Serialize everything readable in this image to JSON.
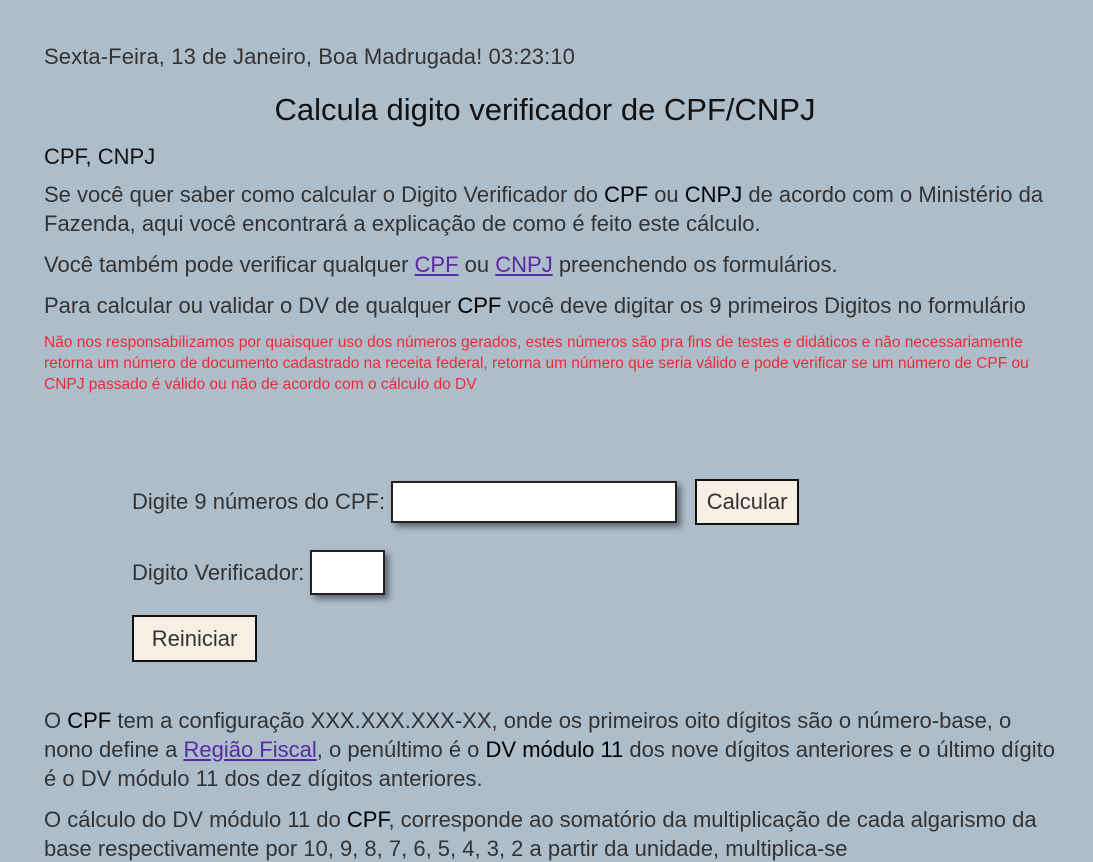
{
  "header": {
    "datetime": "Sexta-Feira, 13 de Janeiro, Boa Madrugada! 03:23:10",
    "title": "Calcula digito verificador de CPF/CNPJ",
    "subtitle": "CPF, CNPJ"
  },
  "intro": {
    "p1_part1": "Se você quer saber como calcular o Digito Verificador do ",
    "p1_cpf": "CPF",
    "p1_part2": " ou ",
    "p1_cnpj": "CNPJ",
    "p1_part3": " de acordo com o Ministério da Fazenda, aqui você encontrará a explicação de como é feito este cálculo.",
    "p2_part1": "Você também pode verificar qualquer ",
    "p2_link_cpf": "CPF",
    "p2_part2": " ou ",
    "p2_link_cnpj": "CNPJ",
    "p2_part3": " preenchendo os formulários.",
    "p3_part1": "Para calcular ou validar o DV de qualquer ",
    "p3_cpf": "CPF",
    "p3_part2": " você deve digitar os 9 primeiros Digitos no formulário",
    "disclaimer": "Não nos responsabilizamos por quaisquer uso dos números gerados, estes números são pra fins de testes e didáticos e não necessariamente retorna um número de documento cadastrado na receita federal, retorna um número que seria válido e pode verificar se um número de CPF ou CNPJ passado é válido ou não de acordo com o cálculo do DV"
  },
  "form": {
    "cpf_label": "Digite 9 números do CPF:",
    "cpf_value": "",
    "calc_button": "Calcular",
    "dv_label": "Digito Verificador:",
    "dv_value": "",
    "reset_button": "Reiniciar"
  },
  "explanation": {
    "p1_part1": "O ",
    "p1_cpf": "CPF",
    "p1_part2": " tem a configuração XXX.XXX.XXX-XX, onde os primeiros oito dígitos são o número-base, o nono define a ",
    "p1_link": "Região Fiscal",
    "p1_part3": ", o penúltimo é o ",
    "p1_bold": "DV módulo 11",
    "p1_part4": " dos nove dígitos anteriores e o último dígito é o DV módulo 11 dos dez dígitos anteriores.",
    "p2_part1": "O cálculo do DV módulo 11 do ",
    "p2_cpf": "CPF",
    "p2_part2": ", corresponde ao somatório da multiplicação de cada algarismo da base respectivamente por 10, 9, 8, 7, 6, 5, 4, 3, 2 a partir da unidade, multiplica-se"
  },
  "colors": {
    "background": "#aebdca",
    "link": "#5b2aa3",
    "disclaimer": "#ee2a3a",
    "button_bg": "#f7efe4"
  }
}
